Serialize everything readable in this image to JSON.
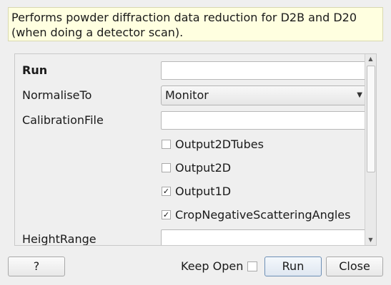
{
  "description": {
    "line1": "Performs powder diffraction data reduction for D2B and D20",
    "line2": "(when doing a detector scan)."
  },
  "form": {
    "run_label": "Run",
    "run_value": "",
    "normalise_label": "NormaliseTo",
    "normalise_value": "Monitor",
    "calibration_label": "CalibrationFile",
    "calibration_value": "",
    "checkboxes": [
      {
        "label": "Output2DTubes",
        "checked": false
      },
      {
        "label": "Output2D",
        "checked": false
      },
      {
        "label": "Output1D",
        "checked": true
      },
      {
        "label": "CropNegativeScatteringAngles",
        "checked": true
      }
    ],
    "height_label": "HeightRange",
    "height_value": ""
  },
  "icons": {
    "combo_arrow": "chevron-down-icon",
    "scroll_up": "arrow-up-icon",
    "scroll_down": "arrow-down-icon",
    "check_mark": "check-icon"
  },
  "footer": {
    "help_label": "?",
    "keep_open_label": "Keep Open",
    "keep_open_checked": false,
    "run_label": "Run",
    "close_label": "Close"
  }
}
